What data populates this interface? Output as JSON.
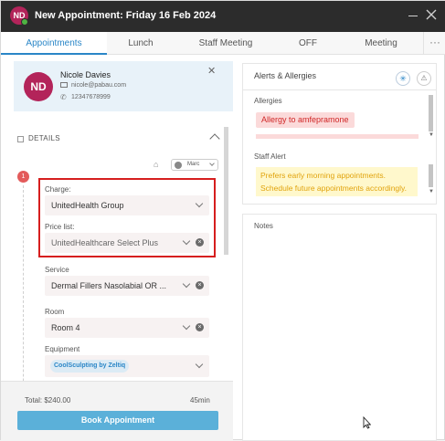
{
  "window": {
    "avatar_initials": "ND",
    "title": "New Appointment: Friday 16 Feb 2024"
  },
  "tabs": [
    {
      "label": "Appointments",
      "active": true
    },
    {
      "label": "Lunch"
    },
    {
      "label": "Staff Meeting"
    },
    {
      "label": "OFF"
    },
    {
      "label": "Meeting"
    }
  ],
  "tabs_more": "···",
  "client": {
    "initials": "ND",
    "name": "Nicole Davies",
    "email": "nicole@pabau.com",
    "phone": "12347678999"
  },
  "details": {
    "label": "DETAILS",
    "staff_selected": "Marc"
  },
  "step_number": "1",
  "form": {
    "charge_label": "Charge:",
    "charge_value": "UnitedHealth Group",
    "pricelist_label": "Price list:",
    "pricelist_value": "UnitedHealthcare Select Plus",
    "service_label": "Service",
    "service_value": "Dermal Fillers Nasolabial OR ...",
    "room_label": "Room",
    "room_value": "Room 4",
    "equipment_label": "Equipment",
    "equipment_chip": "CoolSculpting by Zeltiq"
  },
  "footer": {
    "total": "Total: $240.00",
    "duration": "45min",
    "book_label": "Book Appointment"
  },
  "alerts": {
    "title": "Alerts & Allergies",
    "allergies_label": "Allergies",
    "allergy_item": "Allergy to amfepramone",
    "staff_alert_label": "Staff Alert",
    "staff_alert_text": "Prefers early morning appointments. Schedule future appointments accordingly."
  },
  "notes": {
    "title": "Notes"
  },
  "colors": {
    "accent": "#2a86c7",
    "avatar": "#b3245a",
    "online": "#4fb443",
    "highlight_border": "#d61e1e",
    "allergy_text": "#d02626",
    "staff_alert_text": "#e1a30c",
    "book_button": "#5bb0d9"
  }
}
